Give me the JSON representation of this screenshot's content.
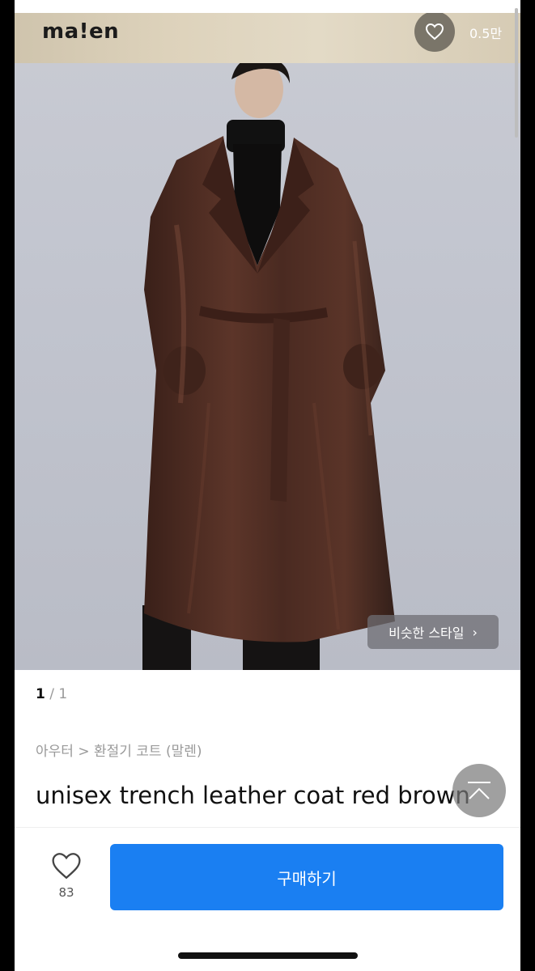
{
  "brand": {
    "logo_text": "ma!en"
  },
  "hero": {
    "like_count": "0.5만",
    "similar_style_label": "비슷한 스타일",
    "similar_style_chevron": "›"
  },
  "pager": {
    "current": "1",
    "separator": "/",
    "total": "1"
  },
  "product": {
    "breadcrumb": "아우터 > 환절기 코트 (말렌)",
    "title": "unisex trench leather coat red brown"
  },
  "bottom_bar": {
    "wishlist_count": "83",
    "buy_label": "구매하기"
  },
  "colors": {
    "accent": "#1a7ff2",
    "coat": "#4a2a22",
    "background": "#c5c8d0"
  },
  "icons": [
    "heart-icon",
    "chevron-right-icon",
    "scroll-top-icon",
    "heart-outline-icon"
  ]
}
